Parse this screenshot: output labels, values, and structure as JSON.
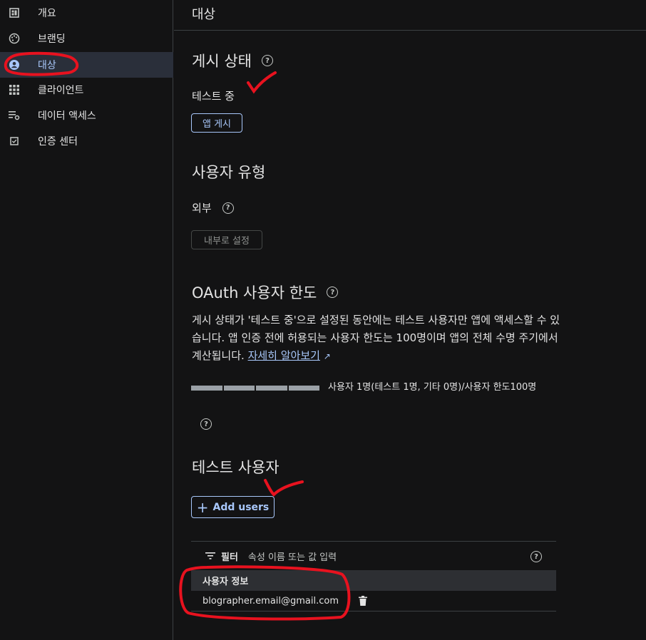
{
  "sidebar": {
    "items": [
      {
        "label": "개요",
        "icon": "dashboard-icon"
      },
      {
        "label": "브랜딩",
        "icon": "palette-icon"
      },
      {
        "label": "대상",
        "icon": "account-circle-icon",
        "active": true
      },
      {
        "label": "클라이언트",
        "icon": "grid-icon"
      },
      {
        "label": "데이터 액세스",
        "icon": "data-settings-icon"
      },
      {
        "label": "인증 센터",
        "icon": "checkbox-icon"
      }
    ]
  },
  "header": {
    "title": "대상"
  },
  "publish": {
    "title": "게시 상태",
    "status": "테스트 중",
    "button": "앱 게시"
  },
  "user_type": {
    "title": "사용자 유형",
    "value": "외부",
    "button": "내부로 설정"
  },
  "oauth": {
    "title": "OAuth 사용자 한도",
    "description": "게시 상태가 '테스트 중'으로 설정된 동안에는 테스트 사용자만 앱에 액세스할 수 있습니다. 앱 인증 전에 허용되는 사용자 한도는 100명이며 앱의 전체 수명 주기에서 계산됩니다.",
    "link": "자세히 알아보기",
    "usage_text": "사용자 1명(테스트 1명, 기타 0명)/사용자 한도100명",
    "usage_fraction": 0.01
  },
  "test_users": {
    "title": "테스트 사용자",
    "add_button": "Add users",
    "filter_label": "필터",
    "filter_placeholder": "속성 이름 또는 값 입력",
    "column_header": "사용자 정보",
    "rows": [
      "blographer.email@gmail.com"
    ]
  },
  "colors": {
    "accent": "#a8c7fa",
    "annotation": "#e8121f",
    "background": "#131314"
  }
}
